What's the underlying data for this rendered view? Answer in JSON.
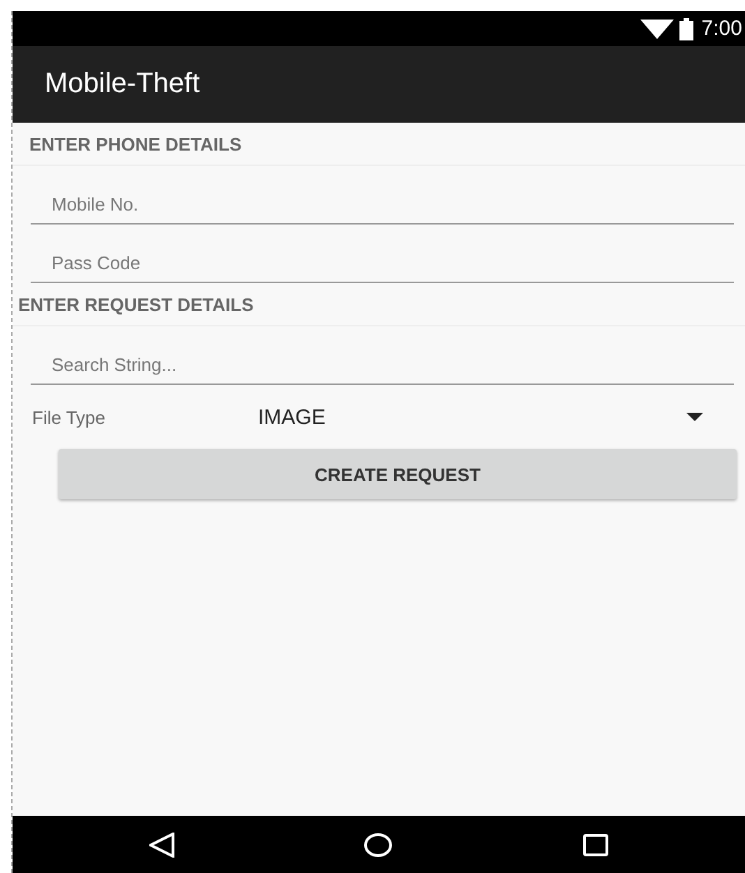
{
  "status_bar": {
    "time": "7:00"
  },
  "app_bar": {
    "title": "Mobile-Theft"
  },
  "sections": [
    {
      "heading": "ENTER PHONE DETAILS",
      "fields": [
        {
          "placeholder": "Mobile No."
        },
        {
          "placeholder": "Pass Code"
        }
      ]
    },
    {
      "heading": "ENTER REQUEST DETAILS",
      "fields": [
        {
          "placeholder": "Search String..."
        }
      ]
    }
  ],
  "file_type": {
    "label": "File Type",
    "value": "IMAGE"
  },
  "button": "CREATE REQUEST"
}
